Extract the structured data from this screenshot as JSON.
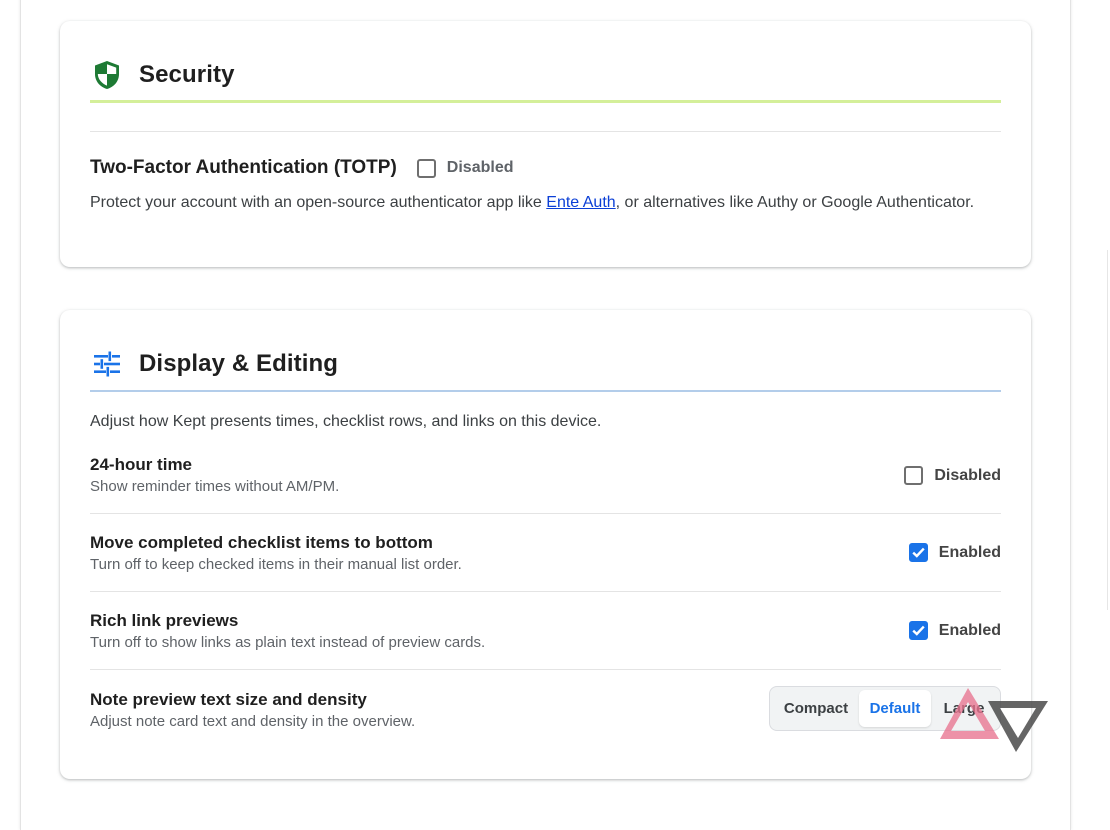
{
  "security": {
    "title": "Security",
    "totp": {
      "title": "Two-Factor Authentication (TOTP)",
      "state_label": "Disabled",
      "enabled": false,
      "desc_before": "Protect your account with an open-source authenticator app like ",
      "link_text": "Ente Auth",
      "desc_after": ", or alternatives like Authy or Google Authenticator."
    }
  },
  "display": {
    "title": "Display & Editing",
    "intro": "Adjust how Kept presents times, checklist rows, and links on this device.",
    "settings": [
      {
        "title": "24-hour time",
        "subtitle": "Show reminder times without AM/PM.",
        "state_label": "Disabled",
        "enabled": false
      },
      {
        "title": "Move completed checklist items to bottom",
        "subtitle": "Turn off to keep checked items in their manual list order.",
        "state_label": "Enabled",
        "enabled": true
      },
      {
        "title": "Rich link previews",
        "subtitle": "Turn off to show links as plain text instead of preview cards.",
        "state_label": "Enabled",
        "enabled": true
      }
    ],
    "density": {
      "title": "Note preview text size and density",
      "subtitle": "Adjust note card text and density in the overview.",
      "options": [
        "Compact",
        "Default",
        "Large"
      ],
      "selected": "Default"
    }
  },
  "colors": {
    "security_accent": "#d4ef9a",
    "display_accent": "#b3cdea",
    "shield": "#1e7a34",
    "checkbox_on": "#1a73e8",
    "tune_icon": "#1a73e8"
  },
  "icons": {
    "security": "shield-icon",
    "display": "tune-sliders-icon",
    "watermark": "watermark-logo"
  }
}
